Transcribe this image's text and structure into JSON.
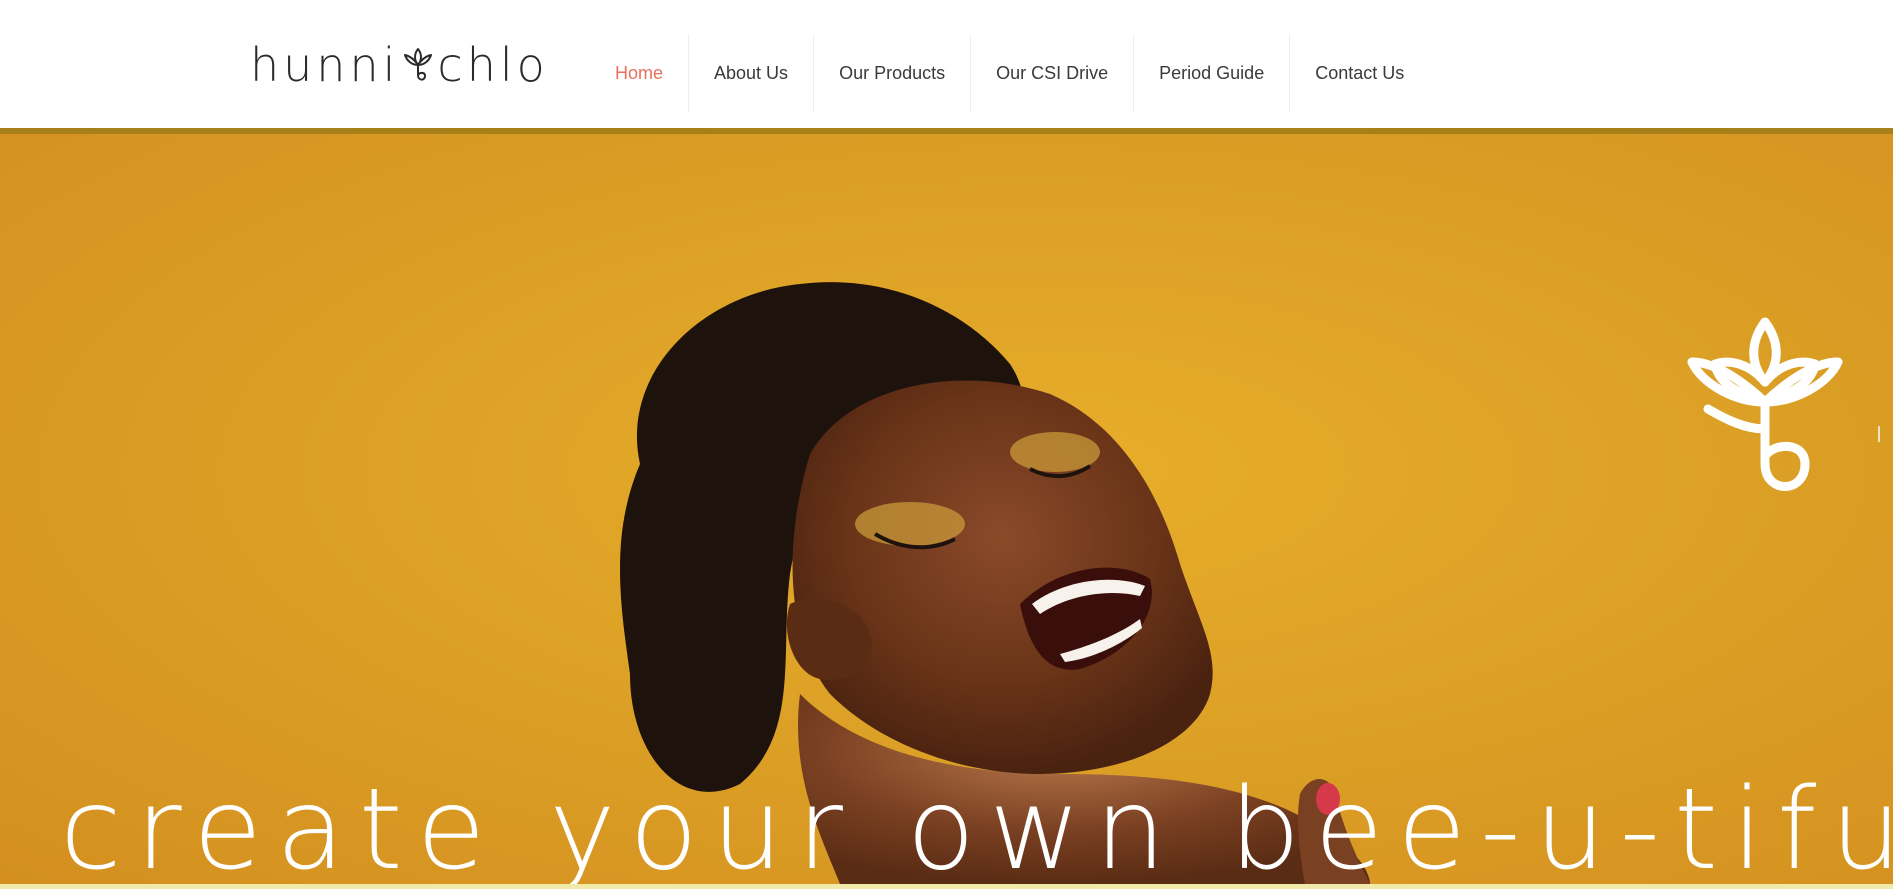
{
  "brand": {
    "logo_left": "hunni",
    "logo_right": "chlo"
  },
  "nav": {
    "items": [
      {
        "label": "Home",
        "active": true
      },
      {
        "label": "About Us",
        "active": false
      },
      {
        "label": "Our Products",
        "active": false
      },
      {
        "label": "Our CSI Drive",
        "active": false
      },
      {
        "label": "Period Guide",
        "active": false
      },
      {
        "label": "Contact Us",
        "active": false
      }
    ]
  },
  "hero": {
    "tagline": "create your own bee-u-tiful"
  },
  "colors": {
    "active_nav": "#e8705d",
    "nav_text": "#3a3a3a",
    "hero_background": "#dca126",
    "hero_border": "#a8801a",
    "top_icons": "#2f5fa7"
  },
  "icons": [
    "lotus-logo-icon",
    "lotus-brand-mark-icon"
  ]
}
